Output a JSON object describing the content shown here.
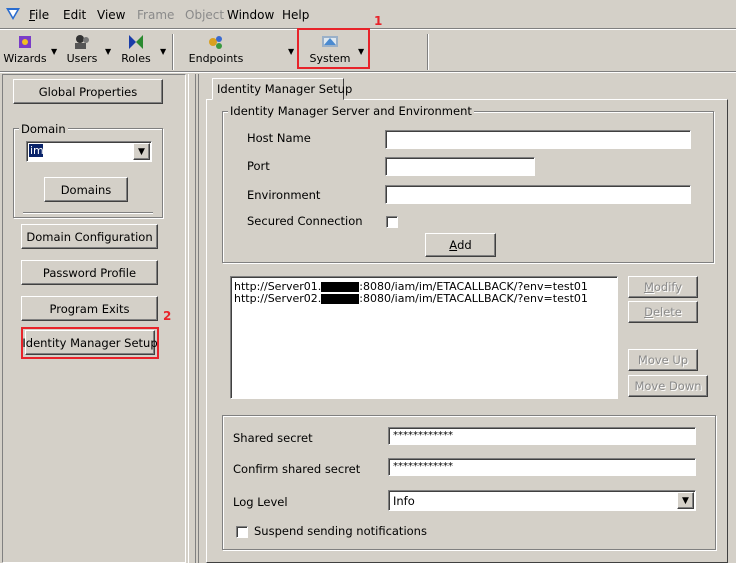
{
  "menu": {
    "file": "File",
    "edit": "Edit",
    "view": "View",
    "frame": "Frame",
    "object": "Object",
    "window": "Window",
    "help": "Help"
  },
  "toolbar": {
    "wizards": "Wizards",
    "users": "Users",
    "roles": "Roles",
    "endpoints": "Endpoints",
    "system": "System"
  },
  "annotations": {
    "one": "1",
    "two": "2",
    "color": "#e8232a"
  },
  "sidebar": {
    "global_properties": "Global Properties",
    "domain_group": "Domain",
    "domain_value": "im",
    "domains": "Domains",
    "domain_configuration": "Domain Configuration",
    "password_profile": "Password Profile",
    "program_exits": "Program Exits",
    "identity_manager_setup": "Identity Manager Setup"
  },
  "main": {
    "tab": "Identity Manager Setup",
    "server_group": "Identity Manager Server and Environment",
    "host_name": "Host Name",
    "port": "Port",
    "environment": "Environment",
    "secured_connection": "Secured Connection",
    "add": "Add",
    "list_items": [
      {
        "prefix": "http://Server01.",
        "suffix": ":8080/iam/im/ETACALLBACK/?env=test01"
      },
      {
        "prefix": "http://Server02.",
        "suffix": ":8080/iam/im/ETACALLBACK/?env=test01"
      }
    ],
    "modify": "Modify",
    "delete": "Delete",
    "move_up": "Move Up",
    "move_down": "Move Down",
    "shared_secret": "Shared secret",
    "shared_secret_value": "************",
    "confirm_shared_secret": "Confirm shared secret",
    "confirm_shared_secret_value": "************",
    "log_level": "Log Level",
    "log_level_value": "Info",
    "suspend_notifications": "Suspend sending notifications"
  }
}
